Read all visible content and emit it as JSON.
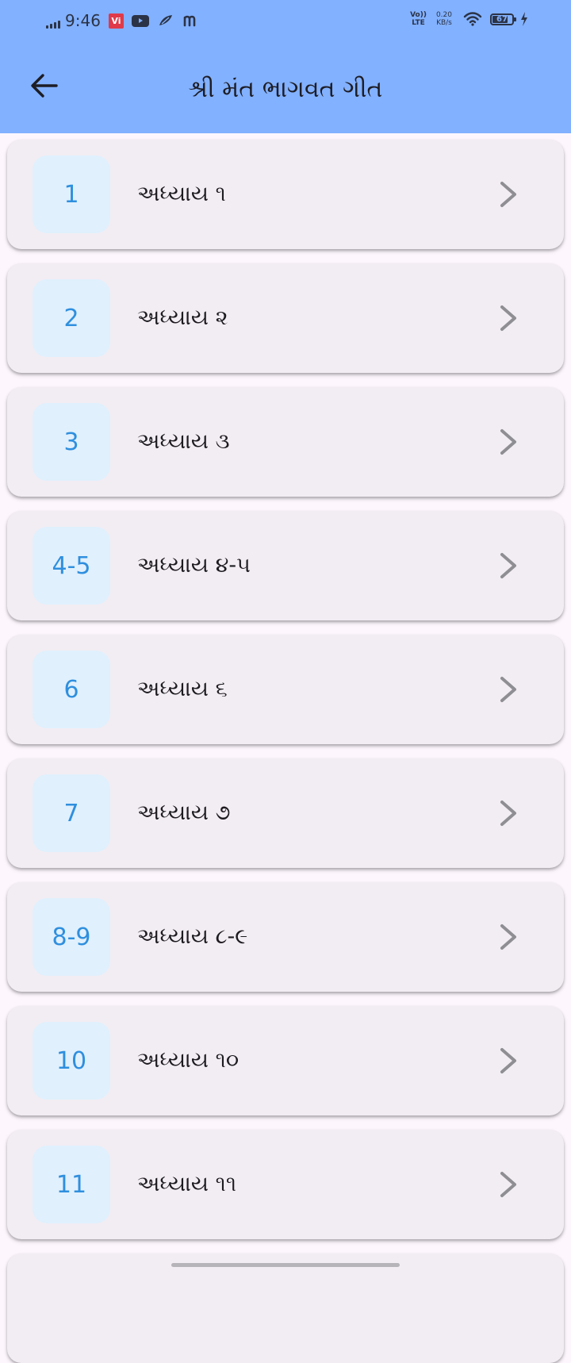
{
  "status_bar": {
    "time": "9:46",
    "vi_label": "Vi",
    "volte_line1": "Vo))",
    "volte_line2": "LTE",
    "speed_value": "0.20",
    "speed_unit": "KB/s",
    "battery": "67"
  },
  "app_bar": {
    "title": "શ્રી મંત ભાગવત ગીત",
    "back_icon": "arrow-left-icon"
  },
  "colors": {
    "app_bar": "#82b1ff",
    "card": "#f2edf3",
    "badge_bg": "#e0f0fd",
    "badge_text": "#2f8fde",
    "chevron": "#8e8e93"
  },
  "chapters": [
    {
      "number": "1",
      "label": "અધ્યાય ૧"
    },
    {
      "number": "2",
      "label": "અધ્યાય ૨"
    },
    {
      "number": "3",
      "label": "અધ્યાય ૩"
    },
    {
      "number": "4-5",
      "label": "અધ્યાય ૪-૫"
    },
    {
      "number": "6",
      "label": "અધ્યાય ૬"
    },
    {
      "number": "7",
      "label": "અધ્યાય ૭"
    },
    {
      "number": "8-9",
      "label": "અધ્યાય ૮-૯"
    },
    {
      "number": "10",
      "label": "અધ્યાય ૧૦"
    },
    {
      "number": "11",
      "label": "અધ્યાય ૧૧"
    }
  ]
}
